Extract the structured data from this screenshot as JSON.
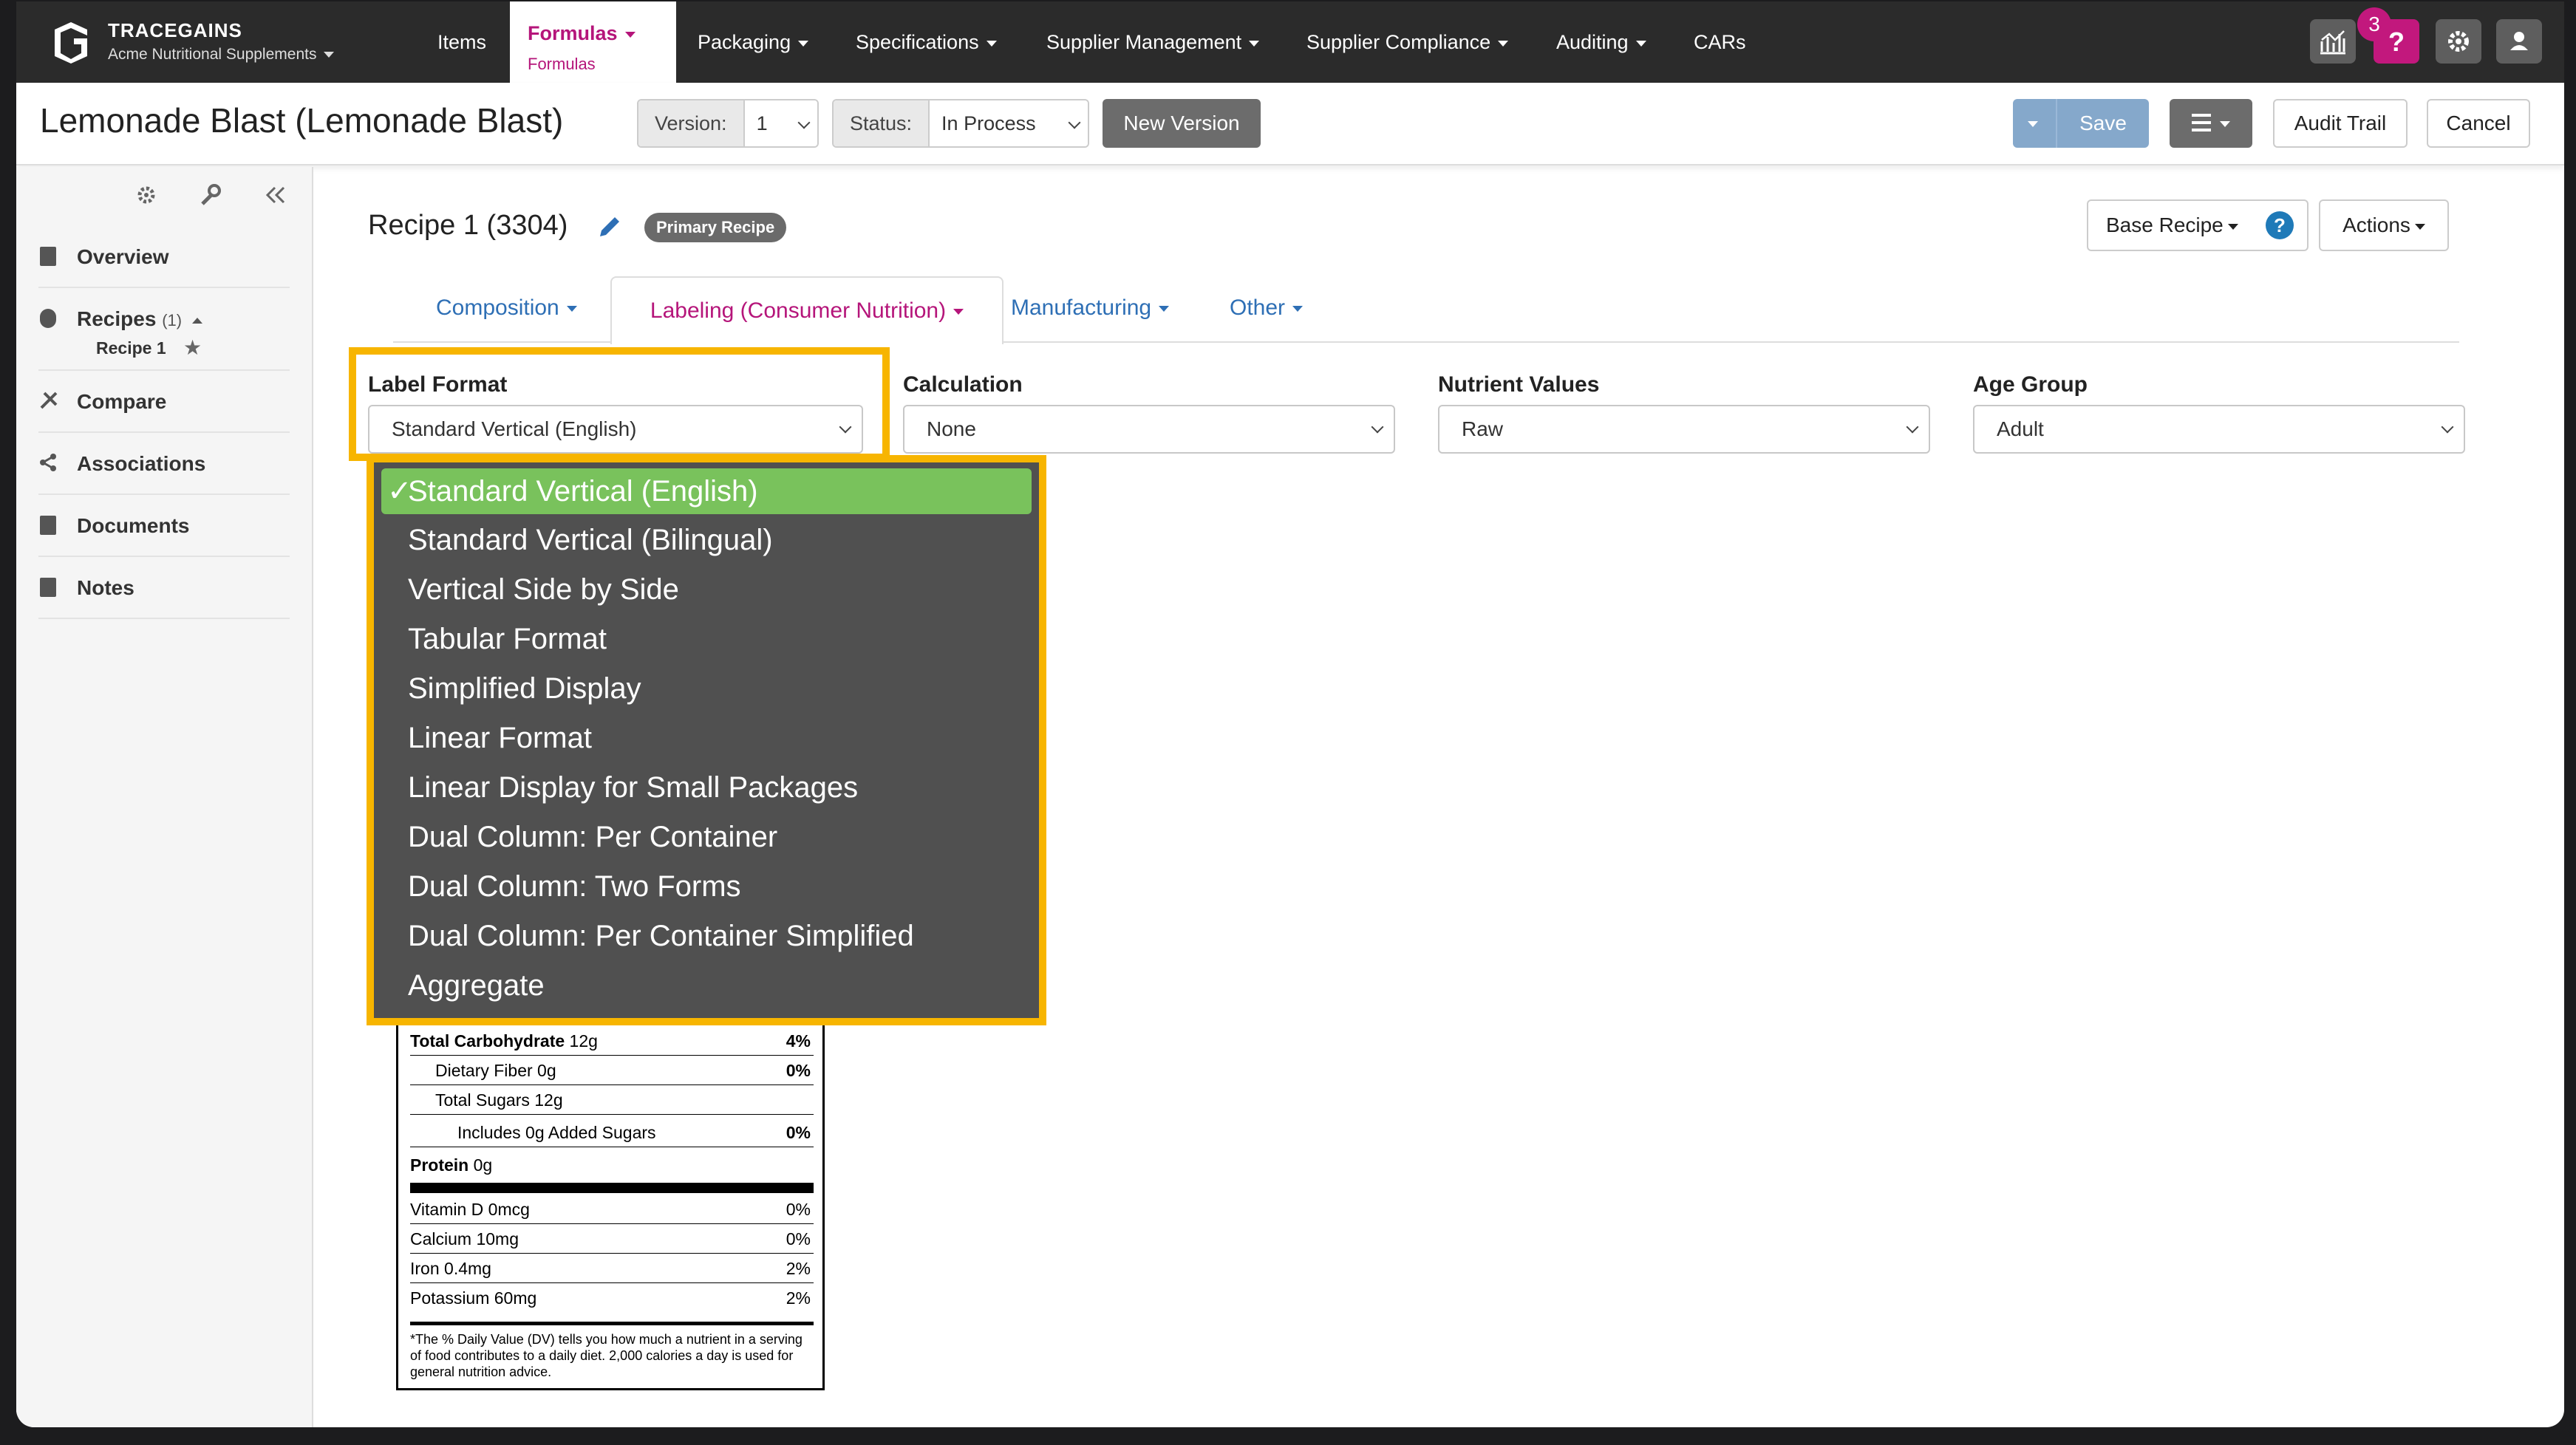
{
  "app": {
    "brand_name": "TRACEGAINS",
    "company": "Acme Nutritional Supplements",
    "nav": [
      "Items",
      "Formulas",
      "Packaging",
      "Specifications",
      "Supplier Management",
      "Supplier Compliance",
      "Auditing",
      "CARs"
    ],
    "active_nav_sub": "Formulas",
    "notification_count": "3",
    "help_label": "?"
  },
  "titlebar": {
    "title": "Lemonade Blast (Lemonade Blast)",
    "version_label": "Version:",
    "version_value": "1",
    "status_label": "Status:",
    "status_value": "In Process",
    "new_version": "New Version",
    "save": "Save",
    "audit_trail": "Audit Trail",
    "cancel": "Cancel"
  },
  "sidebar": {
    "items": [
      "Overview",
      "Recipes",
      "Compare",
      "Associations",
      "Documents",
      "Notes"
    ],
    "recipes_count": "(1)",
    "recipe_sub": "Recipe 1"
  },
  "recipe": {
    "title": "Recipe 1 (3304)",
    "badge": "Primary Recipe",
    "base_recipe": "Base Recipe",
    "actions": "Actions",
    "help_label": "?"
  },
  "tabs": [
    "Composition",
    "Labeling (Consumer Nutrition)",
    "Manufacturing",
    "Other"
  ],
  "fields": {
    "label_format": {
      "label": "Label Format",
      "value": "Standard Vertical (English)"
    },
    "calculation": {
      "label": "Calculation",
      "value": "None"
    },
    "nutrient_values": {
      "label": "Nutrient Values",
      "value": "Raw"
    },
    "age_group": {
      "label": "Age Group",
      "value": "Adult"
    }
  },
  "dropdown": {
    "check": "✓",
    "options": [
      "Standard Vertical (English)",
      "Standard Vertical (Bilingual)",
      "Vertical Side by Side",
      "Tabular Format",
      "Simplified Display",
      "Linear Format",
      "Linear Display for Small Packages",
      "Dual Column: Per Container",
      "Dual Column: Two Forms",
      "Dual Column: Per Container Simplified",
      "Aggregate"
    ]
  },
  "nutrition": {
    "rows": [
      {
        "name": "Total Carbohydrate",
        "amount": " 12g",
        "dv": "4%"
      },
      {
        "name": "Dietary Fiber",
        "amount": " 0g",
        "dv": "0%"
      },
      {
        "name": "Total Sugars",
        "amount": " 12g",
        "dv": ""
      },
      {
        "name": "Includes 0g Added Sugars",
        "amount": "",
        "dv": "0%"
      },
      {
        "name": "Protein",
        "amount": " 0g",
        "dv": ""
      }
    ],
    "vitamins": [
      {
        "name": "Vitamin D 0mcg",
        "dv": "0%"
      },
      {
        "name": "Calcium 10mg",
        "dv": "0%"
      },
      {
        "name": "Iron 0.4mg",
        "dv": "2%"
      },
      {
        "name": "Potassium 60mg",
        "dv": "2%"
      }
    ],
    "footnote": "*The % Daily Value (DV) tells you how much a nutrient in a serving of food contributes to a daily diet. 2,000 calories a day is used for general nutrition advice."
  },
  "colors": {
    "accent": "#b5157a",
    "highlight": "#f7b500",
    "selected_option": "#79c25c",
    "link": "#2e6fb5"
  }
}
